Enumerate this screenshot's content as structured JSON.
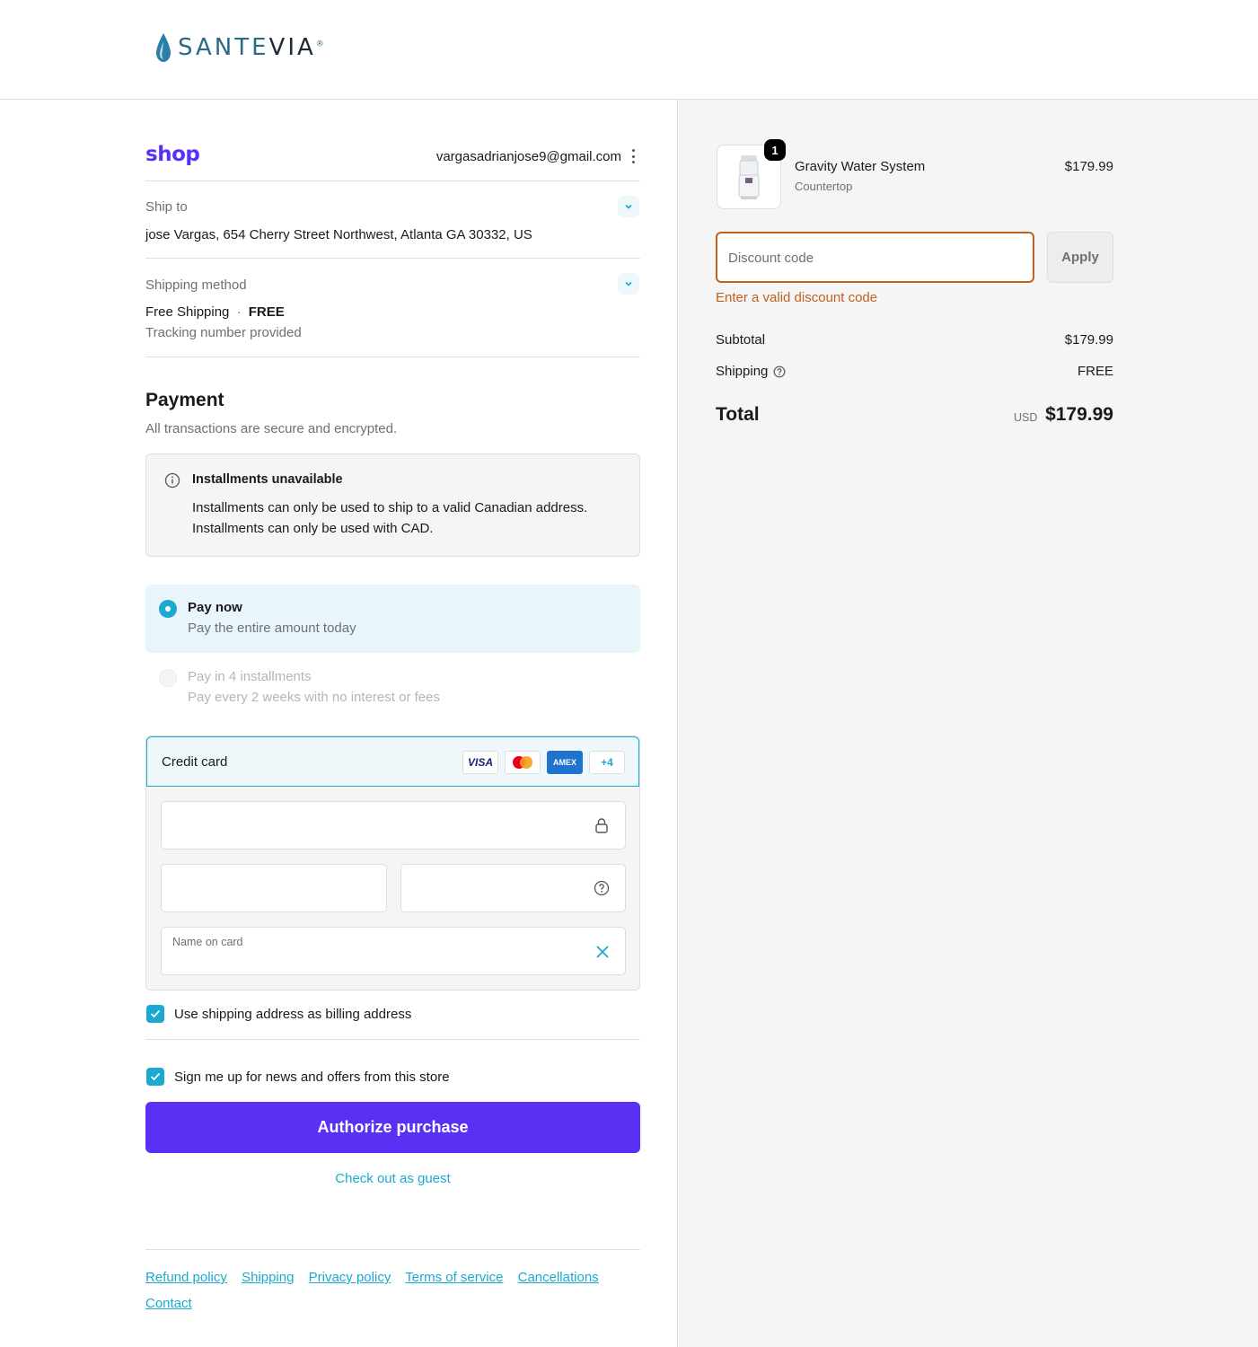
{
  "brand": {
    "part1": "SANTE",
    "part2": "VIA",
    "mark": "®"
  },
  "account": {
    "shop_logo": "shop",
    "email": "vargasadrianjose9@gmail.com"
  },
  "ship_to": {
    "label": "Ship to",
    "address": "jose Vargas, 654 Cherry Street Northwest, Atlanta GA 30332, US"
  },
  "shipping_method": {
    "label": "Shipping method",
    "name": "Free Shipping",
    "separator": "·",
    "price": "FREE",
    "note": "Tracking number provided"
  },
  "payment": {
    "title": "Payment",
    "subtitle": "All transactions are secure and encrypted.",
    "notice": {
      "title": "Installments unavailable",
      "line1": "Installments can only be used to ship to a valid Canadian address.",
      "line2": "Installments can only be used with CAD."
    },
    "options": [
      {
        "title": "Pay now",
        "subtitle": "Pay the entire amount today",
        "selected": true
      },
      {
        "title": "Pay in 4 installments",
        "subtitle": "Pay every 2 weeks with no interest or fees",
        "selected": false
      }
    ],
    "credit_card": {
      "title": "Credit card",
      "logos": [
        "VISA",
        "mastercard",
        "AMEX",
        "+4"
      ],
      "name_label": "Name on card"
    },
    "billing_checkbox": "Use shipping address as billing address",
    "news_checkbox": "Sign me up for news and offers from this store",
    "authorize": "Authorize purchase",
    "guest": "Check out as guest"
  },
  "footer_links": [
    "Refund policy",
    "Shipping",
    "Privacy policy",
    "Terms of service",
    "Cancellations",
    "Contact"
  ],
  "order": {
    "item": {
      "name": "Gravity Water System",
      "variant": "Countertop",
      "price": "$179.99",
      "quantity": "1"
    },
    "discount": {
      "placeholder": "Discount code",
      "apply": "Apply",
      "error": "Enter a valid discount code"
    },
    "subtotal_label": "Subtotal",
    "subtotal": "$179.99",
    "shipping_label": "Shipping",
    "shipping": "FREE",
    "total_label": "Total",
    "currency": "USD",
    "total": "$179.99"
  },
  "colors": {
    "accent": "#1ba9d1",
    "shop_purple": "#5a31f4",
    "error": "#c0621f"
  }
}
